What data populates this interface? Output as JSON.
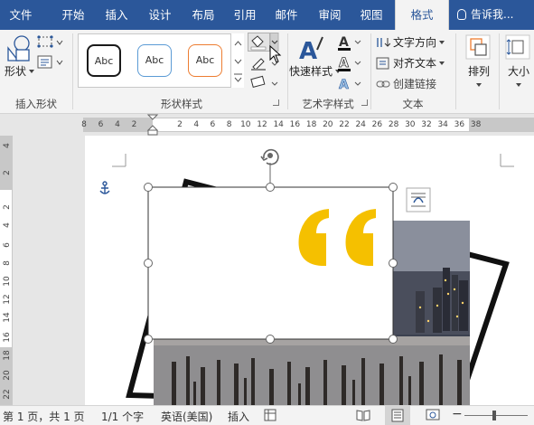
{
  "tabs": [
    "文件",
    "开始",
    "插入",
    "设计",
    "布局",
    "引用",
    "邮件",
    "审阅",
    "视图",
    "格式"
  ],
  "tell_me": "告诉我...",
  "ribbon": {
    "insert_shapes": {
      "label": "插入形状",
      "shape_button": "形状"
    },
    "shape_styles": {
      "label": "形状样式",
      "gallery": [
        "Abc",
        "Abc",
        "Abc"
      ]
    },
    "wordart": {
      "label": "艺术字样式",
      "quick_styles": "快速样式"
    },
    "text": {
      "label": "文本",
      "text_direction": "文字方向",
      "align_text": "对齐文本",
      "create_link": "创建链接"
    },
    "arrange": {
      "label": "排列"
    },
    "size": {
      "label": "大小"
    }
  },
  "ruler": {
    "horizontal": [
      "8",
      "6",
      "4",
      "2",
      "2",
      "4",
      "6",
      "8",
      "10",
      "12",
      "14",
      "16",
      "18",
      "20",
      "22",
      "24",
      "26",
      "28",
      "30",
      "32",
      "34",
      "36",
      "38"
    ],
    "vertical": [
      "4",
      "2",
      "2",
      "4",
      "6",
      "8",
      "10",
      "12",
      "14",
      "16",
      "18",
      "20",
      "22"
    ]
  },
  "status": {
    "page": "第 1 页，共 1 页",
    "words": "1/1 个字",
    "language": "英语(美国)",
    "mode": "插入"
  },
  "colors": {
    "accent": "#2b579a",
    "quote": "#f5c000",
    "style_black": "#1a1a1a",
    "style_blue": "#5b9bd5",
    "style_orange": "#ed7d31"
  }
}
